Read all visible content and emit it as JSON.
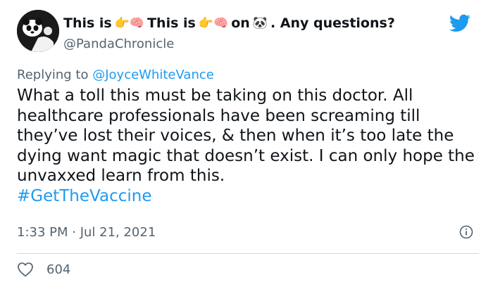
{
  "tweet": {
    "name_part1": "This is",
    "name_part2": "This is",
    "name_part3": "on",
    "name_part4": ". Any questions?",
    "handle": "@PandaChronicle",
    "reply_prefix": "Replying to",
    "reply_to": "@JoyceWhiteVance",
    "text": "What a toll this must be taking on this doctor. All healthcare professionals have been screaming till they’ve lost their voices, & then when it’s too late the dying want magic that doesn’t exist. I can only hope the unvaxxed learn from this.",
    "hashtag": "#GetTheVaccine",
    "timestamp": "1:33 PM · Jul 21, 2021",
    "likes": "604"
  },
  "icons": {
    "name_emoji_1": "👉🧠",
    "name_emoji_2": "👉🧠",
    "name_emoji_3": "🐼",
    "brand": "twitter-bird-icon",
    "info": "info-icon",
    "like": "heart-icon"
  },
  "colors": {
    "accent": "#1d9bf0",
    "muted": "#536471",
    "text": "#0f1419",
    "divider": "#cfd9de"
  }
}
